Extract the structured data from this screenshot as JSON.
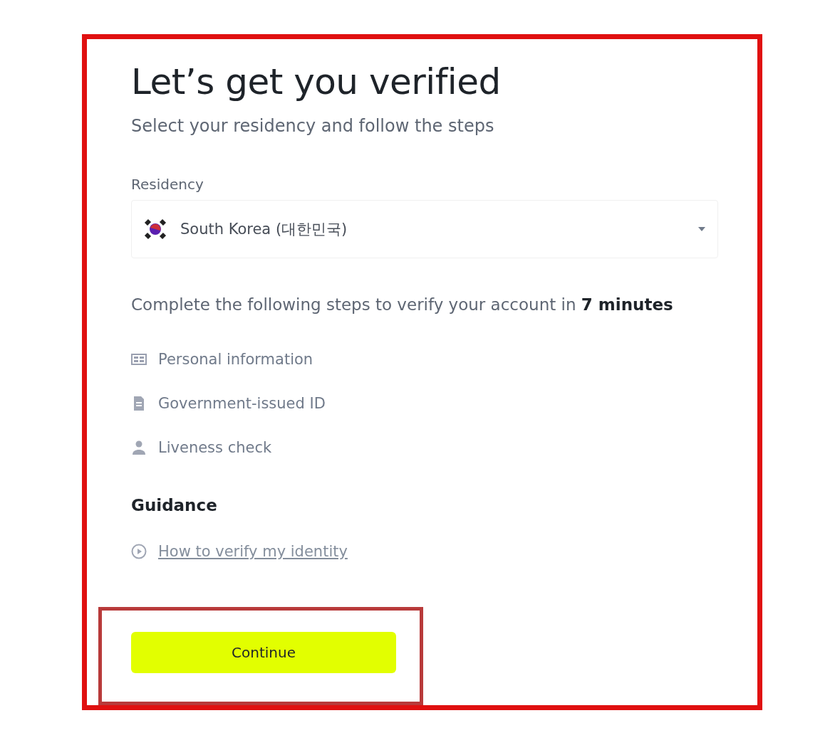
{
  "title": "Let’s get you verified",
  "subtitle": "Select your residency and follow the steps",
  "residency": {
    "label": "Residency",
    "value": "South Korea (대한민국)"
  },
  "steps_intro": "Complete the following steps to verify your account in **7 minutes**",
  "steps": [
    {
      "kind": "form",
      "label": "Personal information"
    },
    {
      "kind": "document",
      "label": "Government-issued ID"
    },
    {
      "kind": "person",
      "label": "Liveness check"
    }
  ],
  "guidance": {
    "heading": "Guidance",
    "link": "How to verify my identity"
  },
  "continue_button": "Continue"
}
